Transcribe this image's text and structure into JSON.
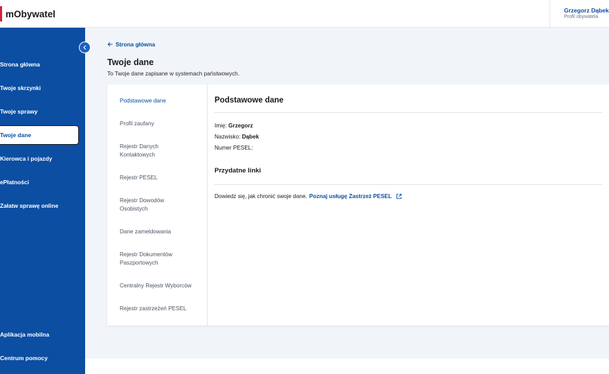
{
  "header": {
    "brand": "mObywatel",
    "user_name": "Grzegorz Dąbek",
    "user_subtitle": "Profil obywatela"
  },
  "sidebar": {
    "items": [
      {
        "label": "Strona główna",
        "active": false
      },
      {
        "label": "Twoje skrzynki",
        "active": false
      },
      {
        "label": "Twoje sprawy",
        "active": false
      },
      {
        "label": "Twoje dane",
        "active": true
      },
      {
        "label": "Kierowca i pojazdy",
        "active": false
      },
      {
        "label": "ePłatności",
        "active": false
      },
      {
        "label": "Załatw sprawę online",
        "active": false
      }
    ],
    "bottom_items": [
      {
        "label": "Aplikacja mobilna"
      },
      {
        "label": "Centrum pomocy"
      }
    ]
  },
  "main": {
    "back_link": "Strona główna",
    "title": "Twoje dane",
    "subtitle": "To Twoje dane zapisane w systemach państwowych.",
    "tabs": [
      {
        "label": "Podstawowe dane",
        "active": true
      },
      {
        "label": "Profil zaufany",
        "active": false
      },
      {
        "label": "Rejestr Danych Kontaktowych",
        "active": false
      },
      {
        "label": "Rejestr PESEL",
        "active": false
      },
      {
        "label": "Rejestr Dowodów Osobistych",
        "active": false
      },
      {
        "label": "Dane zameldowania",
        "active": false
      },
      {
        "label": "Rejestr Dokumentów Paszportowych",
        "active": false
      },
      {
        "label": "Centralny Rejestr Wyborców",
        "active": false
      },
      {
        "label": "Rejestr zastrzeżeń PESEL",
        "active": false
      }
    ],
    "section_title": "Podstawowe dane",
    "fields": {
      "first_name_label": "Imię:",
      "first_name_value": "Grzegorz",
      "last_name_label": "Nazwisko:",
      "last_name_value": "Dąbek",
      "pesel_label": "Numer PESEL:",
      "pesel_value": ""
    },
    "links_title": "Przydatne linki",
    "link_text": "Dowiedz się, jak chronić swoje dane.",
    "link_label": "Poznaj usługę Zastrzeż PESEL"
  },
  "colors": {
    "sidebar_bg": "#0b4ea2",
    "accent": "#0b4ea2",
    "brand_red": "#d4213d",
    "main_bg": "#f1f5fa"
  },
  "icons": {
    "collapse": "chevron-left-icon",
    "back": "arrow-left-icon",
    "external": "external-link-icon"
  }
}
